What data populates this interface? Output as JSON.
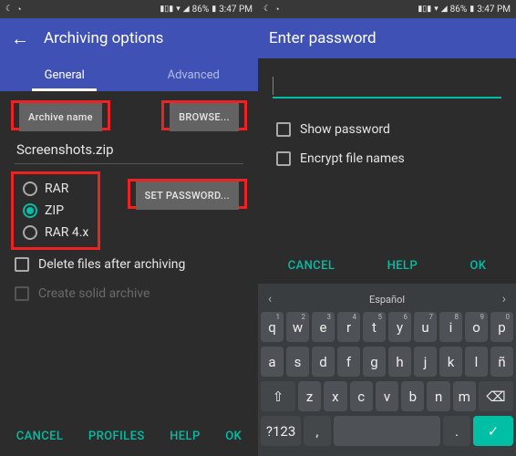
{
  "status": {
    "battery_pct": "86%",
    "time": "3:47 PM"
  },
  "left": {
    "title": "Archiving options",
    "tabs": {
      "general": "General",
      "advanced": "Advanced"
    },
    "archive_name_label": "Archive name",
    "browse": "BROWSE...",
    "filename": "Screenshots.zip",
    "formats": {
      "rar": "RAR",
      "zip": "ZIP",
      "rar4x": "RAR 4.x"
    },
    "set_password": "SET PASSWORD...",
    "delete_after": "Delete files after archiving",
    "solid": "Create solid archive",
    "actions": {
      "cancel": "CANCEL",
      "profiles": "PROFILES",
      "help": "HELP",
      "ok": "OK"
    }
  },
  "right": {
    "title": "Enter password",
    "show_pw": "Show password",
    "encrypt": "Encrypt file names",
    "actions": {
      "cancel": "CANCEL",
      "help": "HELP",
      "ok": "OK"
    },
    "keyboard": {
      "lang_label": "Español",
      "mode_key": "?123",
      "rows": [
        [
          [
            "q",
            "1"
          ],
          [
            "w",
            "2"
          ],
          [
            "e",
            "3"
          ],
          [
            "r",
            "4"
          ],
          [
            "t",
            "5"
          ],
          [
            "y",
            "6"
          ],
          [
            "u",
            "7"
          ],
          [
            "i",
            "8"
          ],
          [
            "o",
            "9"
          ],
          [
            "p",
            "0"
          ]
        ],
        [
          [
            "a",
            ""
          ],
          [
            "s",
            ""
          ],
          [
            "d",
            ""
          ],
          [
            "f",
            ""
          ],
          [
            "g",
            ""
          ],
          [
            "h",
            ""
          ],
          [
            "j",
            ""
          ],
          [
            "k",
            ""
          ],
          [
            "l",
            ""
          ],
          [
            "ñ",
            ""
          ]
        ],
        [
          [
            "z",
            ""
          ],
          [
            "x",
            ""
          ],
          [
            "c",
            ""
          ],
          [
            "v",
            ""
          ],
          [
            "b",
            ""
          ],
          [
            "n",
            ""
          ],
          [
            "m",
            ""
          ]
        ]
      ]
    }
  }
}
